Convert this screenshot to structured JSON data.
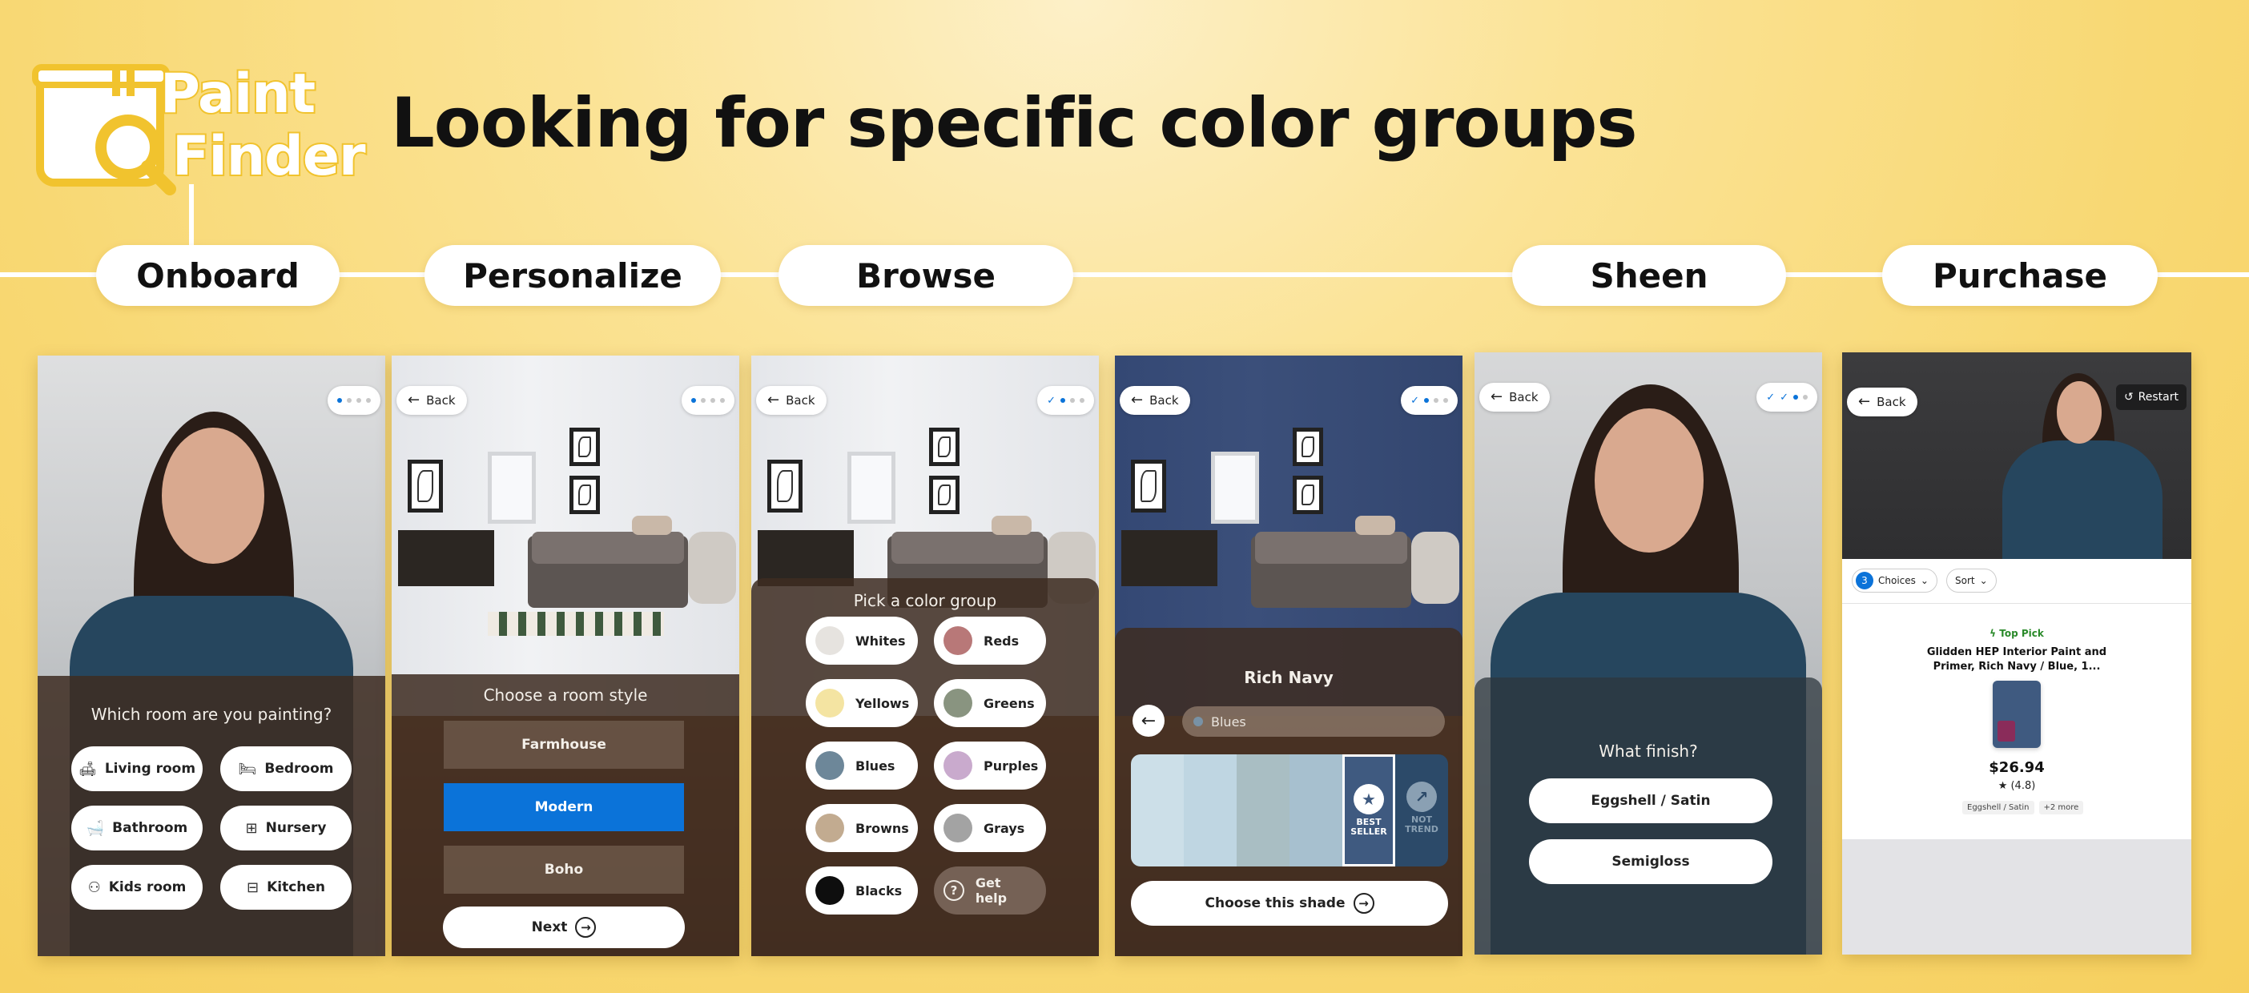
{
  "brand": {
    "logo_line1": "Paint",
    "logo_line2": "Finder",
    "accent": "#f1c32e"
  },
  "headline": "Looking for specific color groups",
  "steps": [
    "Onboard",
    "Personalize",
    "Browse",
    "Sheen",
    "Purchase"
  ],
  "colors": {
    "primary_blue": "#0b73d9",
    "panel_overlay": "#3e2c22",
    "background": "#f8d873"
  },
  "common": {
    "back": "Back",
    "restart": "Restart"
  },
  "screen1": {
    "question": "Which room are you painting?",
    "rooms": [
      {
        "label": "Living room",
        "icon": "sofa-icon",
        "glyph": "🛋"
      },
      {
        "label": "Bedroom",
        "icon": "bed-icon",
        "glyph": "🛏"
      },
      {
        "label": "Bathroom",
        "icon": "bath-icon",
        "glyph": "🛁"
      },
      {
        "label": "Nursery",
        "icon": "crib-icon",
        "glyph": "⊞"
      },
      {
        "label": "Kids room",
        "icon": "toy-icon",
        "glyph": "⚇"
      },
      {
        "label": "Kitchen",
        "icon": "kitchen-icon",
        "glyph": "⊟"
      }
    ]
  },
  "screen2": {
    "question": "Choose a room style",
    "options": [
      "Farmhouse",
      "Modern",
      "Boho"
    ],
    "selected": "Modern",
    "next": "Next"
  },
  "screen3": {
    "question": "Pick a color group",
    "groups": [
      {
        "label": "Whites",
        "color": "#e6e3df"
      },
      {
        "label": "Reds",
        "color": "#b87878"
      },
      {
        "label": "Yellows",
        "color": "#f4e4a2"
      },
      {
        "label": "Greens",
        "color": "#899480"
      },
      {
        "label": "Blues",
        "color": "#6d8799"
      },
      {
        "label": "Purples",
        "color": "#c9aacd"
      },
      {
        "label": "Browns",
        "color": "#c2ab90"
      },
      {
        "label": "Grays",
        "color": "#a3a3a3"
      },
      {
        "label": "Blacks",
        "color": "#0e0e0e"
      }
    ],
    "help": "Get help"
  },
  "screen4": {
    "shade_name": "Rich Navy",
    "group": "Blues",
    "shades": [
      "#ccdfe8",
      "#bfd6e2",
      "#a9bec3",
      "#a7c0cf",
      "#3f5a80",
      "#2c4a69"
    ],
    "best_seller": "BEST SELLER",
    "not_trend_1": "NOT",
    "not_trend_2": "TREND",
    "cta": "Choose this shade",
    "wall_color": "#3b4f7a"
  },
  "screen5": {
    "question": "What finish?",
    "options": [
      "Eggshell / Satin",
      "Semigloss"
    ]
  },
  "screen6": {
    "choices_count": "3",
    "choices_label": "Choices",
    "sort_label": "Sort",
    "top_pick": "Top Pick",
    "product_title_1": "Glidden HEP Interior Paint and",
    "product_title_2": "Primer, Rich Navy / Blue, 1...",
    "price": "$26.94",
    "rating": "★ (4.8)",
    "tags": [
      "Eggshell / Satin",
      "+2 more"
    ]
  }
}
